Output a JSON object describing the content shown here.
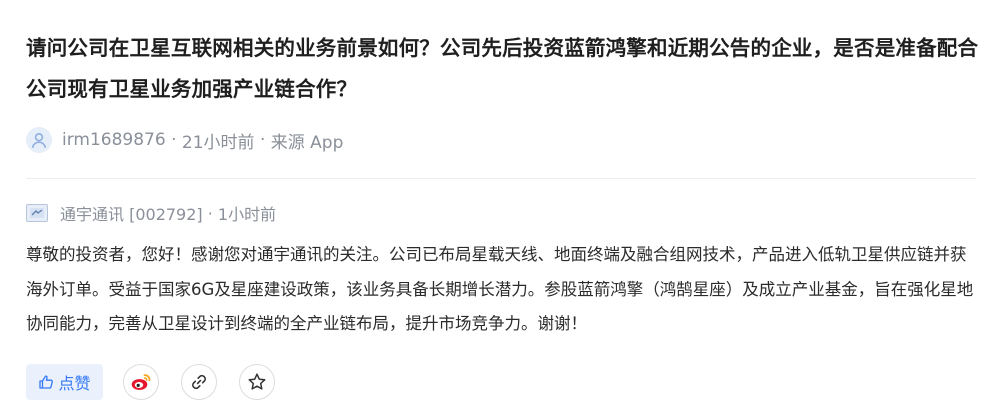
{
  "question": {
    "text": "请问公司在卫星互联网相关的业务前景如何？公司先后投资蓝箭鸿擎和近期公告的企业，是否是准备配合公司现有卫星业务加强产业链合作？"
  },
  "meta": {
    "author": "irm1689876",
    "time": "21小时前",
    "source": "来源 App"
  },
  "reply": {
    "company": "通宇通讯 [002792]",
    "time": "1小时前",
    "text": "尊敬的投资者，您好！感谢您对通宇通讯的关注。公司已布局星载天线、地面终端及融合组网技术，产品进入低轨卫星供应链并获海外订单。受益于国家6G及星座建设政策，该业务具备长期增长潜力。参股蓝箭鸿擎（鸿鹄星座）及成立产业基金，旨在强化星地协同能力，完善从卫星设计到终端的全产业链布局，提升市场竞争力。谢谢！"
  },
  "actions": {
    "like_label": "点赞",
    "icons": [
      "thumbs-up-icon",
      "weibo-icon",
      "link-icon",
      "star-icon"
    ]
  },
  "colors": {
    "accent": "#3478f6",
    "like_bg": "#eaf1fc",
    "weibo_red": "#e6162d",
    "weibo_orange": "#f5a623",
    "meta_gray": "#8a8f99"
  }
}
